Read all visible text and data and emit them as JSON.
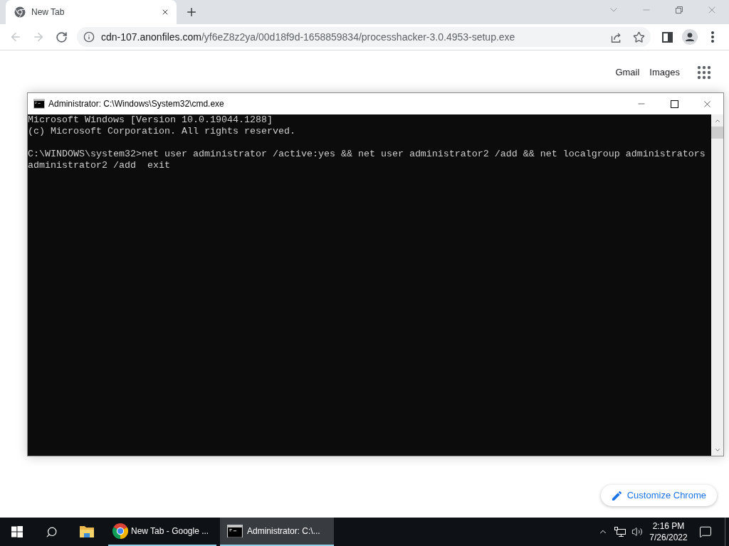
{
  "browser": {
    "tabs": [
      {
        "title": "New Tab",
        "selected": true
      }
    ],
    "toolbar": {
      "back": {
        "disabled": true
      },
      "forward": {
        "disabled": true
      },
      "address": {
        "host": "cdn-107.anonfiles.com",
        "path": "/yf6eZ8z2ya/00d18f9d-1658859834/processhacker-3.0.4953-setup.exe"
      }
    },
    "page": {
      "header_links": [
        "Gmail",
        "Images"
      ],
      "customize_button": "Customize Chrome"
    }
  },
  "console_window": {
    "title": "Administrator: C:\\Windows\\System32\\cmd.exe",
    "lines": [
      {
        "kind": "output",
        "text": "Microsoft Windows [Version 10.0.19044.1288]"
      },
      {
        "kind": "output",
        "text": "(c) Microsoft Corporation. All rights reserved."
      },
      {
        "kind": "command",
        "text": "C:\\WINDOWS\\system32>net user administrator /active:yes && net user administrator2 /add && net localgroup administrators administrator2 /add  exit"
      }
    ]
  },
  "taskbar": {
    "tasks": [
      {
        "kind": "browser",
        "label": "New Tab - Google ...",
        "selected": false
      },
      {
        "kind": "console",
        "label": "Administrator: C:\\...",
        "selected": true
      }
    ],
    "clock": {
      "time": "2:16 PM",
      "date": "7/26/2022"
    }
  }
}
